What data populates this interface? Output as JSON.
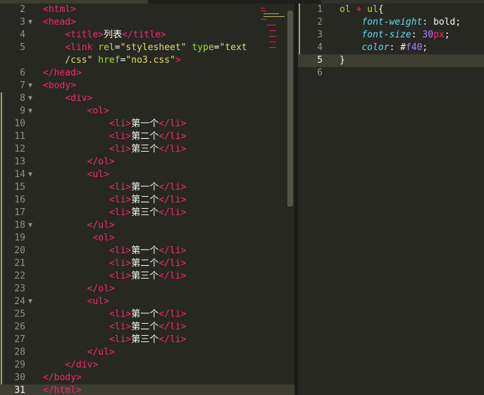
{
  "colors": {
    "background": "#272822",
    "tag": "#f92672",
    "attribute": "#a6e22e",
    "string": "#e6db74",
    "text": "#f8f8f2",
    "property": "#66d9ef",
    "number": "#ae81ff",
    "line_number": "#90908a",
    "current_line": "#3e3d32"
  },
  "left_editor": {
    "lines": [
      {
        "n": "2",
        "fold": "",
        "parts": [
          [
            "t",
            "<"
          ],
          [
            "t",
            "html"
          ],
          [
            "t",
            ">"
          ]
        ]
      },
      {
        "n": "3",
        "fold": "▼",
        "parts": [
          [
            "t",
            "<"
          ],
          [
            "t",
            "head"
          ],
          [
            "t",
            ">"
          ]
        ]
      },
      {
        "n": "4",
        "fold": "",
        "parts": [
          [
            "p",
            "    "
          ],
          [
            "t",
            "<"
          ],
          [
            "t",
            "title"
          ],
          [
            "t",
            ">"
          ],
          [
            "p",
            "列表"
          ],
          [
            "t",
            "</"
          ],
          [
            "t",
            "title"
          ],
          [
            "t",
            ">"
          ]
        ]
      },
      {
        "n": "5",
        "fold": "",
        "parts": [
          [
            "p",
            "    "
          ],
          [
            "t",
            "<"
          ],
          [
            "t",
            "link"
          ],
          [
            "p",
            " "
          ],
          [
            "a",
            "rel"
          ],
          [
            "p",
            "="
          ],
          [
            "s",
            "\"stylesheet\""
          ],
          [
            "p",
            " "
          ],
          [
            "a",
            "type"
          ],
          [
            "p",
            "="
          ],
          [
            "s",
            "\"text"
          ]
        ]
      },
      {
        "n": "",
        "fold": "",
        "parts": [
          [
            "s",
            "    /css\""
          ],
          [
            "p",
            " "
          ],
          [
            "a",
            "href"
          ],
          [
            "p",
            "="
          ],
          [
            "s",
            "\"no3.css\""
          ],
          [
            "t",
            ">"
          ]
        ]
      },
      {
        "n": "6",
        "fold": "",
        "parts": [
          [
            "t",
            "</"
          ],
          [
            "t",
            "head"
          ],
          [
            "t",
            ">"
          ]
        ]
      },
      {
        "n": "7",
        "fold": "▼",
        "parts": [
          [
            "t",
            "<"
          ],
          [
            "t",
            "body"
          ],
          [
            "t",
            ">"
          ]
        ]
      },
      {
        "n": "8",
        "fold": "▼",
        "parts": [
          [
            "p",
            "    "
          ],
          [
            "t",
            "<"
          ],
          [
            "t",
            "div"
          ],
          [
            "t",
            ">"
          ]
        ]
      },
      {
        "n": "9",
        "fold": "▼",
        "parts": [
          [
            "p",
            "        "
          ],
          [
            "t",
            "<"
          ],
          [
            "t",
            "ol"
          ],
          [
            "t",
            ">"
          ]
        ]
      },
      {
        "n": "10",
        "fold": "",
        "parts": [
          [
            "p",
            "            "
          ],
          [
            "t",
            "<"
          ],
          [
            "t",
            "li"
          ],
          [
            "t",
            ">"
          ],
          [
            "p",
            "第一个"
          ],
          [
            "t",
            "</"
          ],
          [
            "t",
            "li"
          ],
          [
            "t",
            ">"
          ]
        ]
      },
      {
        "n": "11",
        "fold": "",
        "parts": [
          [
            "p",
            "            "
          ],
          [
            "t",
            "<"
          ],
          [
            "t",
            "li"
          ],
          [
            "t",
            ">"
          ],
          [
            "p",
            "第二个"
          ],
          [
            "t",
            "</"
          ],
          [
            "t",
            "li"
          ],
          [
            "t",
            ">"
          ]
        ]
      },
      {
        "n": "12",
        "fold": "",
        "parts": [
          [
            "p",
            "            "
          ],
          [
            "t",
            "<"
          ],
          [
            "t",
            "li"
          ],
          [
            "t",
            ">"
          ],
          [
            "p",
            "第三个"
          ],
          [
            "t",
            "</"
          ],
          [
            "t",
            "li"
          ],
          [
            "t",
            ">"
          ]
        ]
      },
      {
        "n": "13",
        "fold": "",
        "parts": [
          [
            "p",
            "        "
          ],
          [
            "t",
            "</"
          ],
          [
            "t",
            "ol"
          ],
          [
            "t",
            ">"
          ]
        ]
      },
      {
        "n": "14",
        "fold": "▼",
        "parts": [
          [
            "p",
            "        "
          ],
          [
            "t",
            "<"
          ],
          [
            "t",
            "ul"
          ],
          [
            "t",
            ">"
          ]
        ]
      },
      {
        "n": "15",
        "fold": "",
        "parts": [
          [
            "p",
            "            "
          ],
          [
            "t",
            "<"
          ],
          [
            "t",
            "li"
          ],
          [
            "t",
            ">"
          ],
          [
            "p",
            "第一个"
          ],
          [
            "t",
            "</"
          ],
          [
            "t",
            "li"
          ],
          [
            "t",
            ">"
          ]
        ]
      },
      {
        "n": "16",
        "fold": "",
        "parts": [
          [
            "p",
            "            "
          ],
          [
            "t",
            "<"
          ],
          [
            "t",
            "li"
          ],
          [
            "t",
            ">"
          ],
          [
            "p",
            "第二个"
          ],
          [
            "t",
            "</"
          ],
          [
            "t",
            "li"
          ],
          [
            "t",
            ">"
          ]
        ]
      },
      {
        "n": "17",
        "fold": "",
        "parts": [
          [
            "p",
            "            "
          ],
          [
            "t",
            "<"
          ],
          [
            "t",
            "li"
          ],
          [
            "t",
            ">"
          ],
          [
            "p",
            "第三个"
          ],
          [
            "t",
            "</"
          ],
          [
            "t",
            "li"
          ],
          [
            "t",
            ">"
          ]
        ]
      },
      {
        "n": "18",
        "fold": "▼",
        "parts": [
          [
            "p",
            "        "
          ],
          [
            "t",
            "</"
          ],
          [
            "t",
            "ul"
          ],
          [
            "t",
            ">"
          ]
        ]
      },
      {
        "n": "19",
        "fold": "",
        "parts": [
          [
            "p",
            "         "
          ],
          [
            "t",
            "<"
          ],
          [
            "t",
            "ol"
          ],
          [
            "t",
            ">"
          ]
        ]
      },
      {
        "n": "20",
        "fold": "",
        "parts": [
          [
            "p",
            "            "
          ],
          [
            "t",
            "<"
          ],
          [
            "t",
            "li"
          ],
          [
            "t",
            ">"
          ],
          [
            "p",
            "第一个"
          ],
          [
            "t",
            "</"
          ],
          [
            "t",
            "li"
          ],
          [
            "t",
            ">"
          ]
        ]
      },
      {
        "n": "21",
        "fold": "",
        "parts": [
          [
            "p",
            "            "
          ],
          [
            "t",
            "<"
          ],
          [
            "t",
            "li"
          ],
          [
            "t",
            ">"
          ],
          [
            "p",
            "第二个"
          ],
          [
            "t",
            "</"
          ],
          [
            "t",
            "li"
          ],
          [
            "t",
            ">"
          ]
        ]
      },
      {
        "n": "22",
        "fold": "",
        "parts": [
          [
            "p",
            "            "
          ],
          [
            "t",
            "<"
          ],
          [
            "t",
            "li"
          ],
          [
            "t",
            ">"
          ],
          [
            "p",
            "第三个"
          ],
          [
            "t",
            "</"
          ],
          [
            "t",
            "li"
          ],
          [
            "t",
            ">"
          ]
        ]
      },
      {
        "n": "23",
        "fold": "",
        "parts": [
          [
            "p",
            "        "
          ],
          [
            "t",
            "</"
          ],
          [
            "t",
            "ol"
          ],
          [
            "t",
            ">"
          ]
        ]
      },
      {
        "n": "24",
        "fold": "▼",
        "parts": [
          [
            "p",
            "        "
          ],
          [
            "t",
            "<"
          ],
          [
            "t",
            "ul"
          ],
          [
            "t",
            ">"
          ]
        ]
      },
      {
        "n": "25",
        "fold": "",
        "parts": [
          [
            "p",
            "            "
          ],
          [
            "t",
            "<"
          ],
          [
            "t",
            "li"
          ],
          [
            "t",
            ">"
          ],
          [
            "p",
            "第一个"
          ],
          [
            "t",
            "</"
          ],
          [
            "t",
            "li"
          ],
          [
            "t",
            ">"
          ]
        ]
      },
      {
        "n": "26",
        "fold": "",
        "parts": [
          [
            "p",
            "            "
          ],
          [
            "t",
            "<"
          ],
          [
            "t",
            "li"
          ],
          [
            "t",
            ">"
          ],
          [
            "p",
            "第二个"
          ],
          [
            "t",
            "</"
          ],
          [
            "t",
            "li"
          ],
          [
            "t",
            ">"
          ]
        ]
      },
      {
        "n": "27",
        "fold": "",
        "parts": [
          [
            "p",
            "            "
          ],
          [
            "t",
            "<"
          ],
          [
            "t",
            "li"
          ],
          [
            "t",
            ">"
          ],
          [
            "p",
            "第三个"
          ],
          [
            "t",
            "</"
          ],
          [
            "t",
            "li"
          ],
          [
            "t",
            ">"
          ]
        ]
      },
      {
        "n": "28",
        "fold": "",
        "parts": [
          [
            "p",
            "        "
          ],
          [
            "t",
            "</"
          ],
          [
            "t",
            "ul"
          ],
          [
            "t",
            ">"
          ]
        ]
      },
      {
        "n": "29",
        "fold": "",
        "parts": [
          [
            "p",
            "    "
          ],
          [
            "t",
            "</"
          ],
          [
            "t",
            "div"
          ],
          [
            "t",
            ">"
          ]
        ]
      },
      {
        "n": "30",
        "fold": "",
        "parts": [
          [
            "t",
            "</"
          ],
          [
            "t",
            "body"
          ],
          [
            "t",
            ">"
          ]
        ]
      },
      {
        "n": "31",
        "fold": "",
        "parts": [
          [
            "t",
            "</"
          ],
          [
            "t",
            "html"
          ],
          [
            "t",
            ">"
          ]
        ]
      }
    ]
  },
  "right_editor": {
    "lines": [
      {
        "n": "1",
        "parts": [
          [
            "sel",
            "ol"
          ],
          [
            "p",
            " "
          ],
          [
            "op",
            "+"
          ],
          [
            "p",
            " "
          ],
          [
            "sel",
            "ul"
          ],
          [
            "p",
            "{"
          ]
        ]
      },
      {
        "n": "2",
        "parts": [
          [
            "p",
            "    "
          ],
          [
            "prop",
            "font-weight"
          ],
          [
            "p",
            ": "
          ],
          [
            "val",
            "bold"
          ],
          [
            "p",
            ";"
          ]
        ]
      },
      {
        "n": "3",
        "parts": [
          [
            "p",
            "    "
          ],
          [
            "prop",
            "font-size"
          ],
          [
            "p",
            ": "
          ],
          [
            "num",
            "30"
          ],
          [
            "unit",
            "px"
          ],
          [
            "p",
            ";"
          ]
        ]
      },
      {
        "n": "4",
        "parts": [
          [
            "p",
            "    "
          ],
          [
            "prop",
            "color"
          ],
          [
            "p",
            ": "
          ],
          [
            "hash",
            "#"
          ],
          [
            "num",
            "f40"
          ],
          [
            "p",
            ";"
          ]
        ]
      },
      {
        "n": "5",
        "parts": [
          [
            "p",
            "}"
          ]
        ]
      },
      {
        "n": "6",
        "parts": []
      }
    ]
  }
}
